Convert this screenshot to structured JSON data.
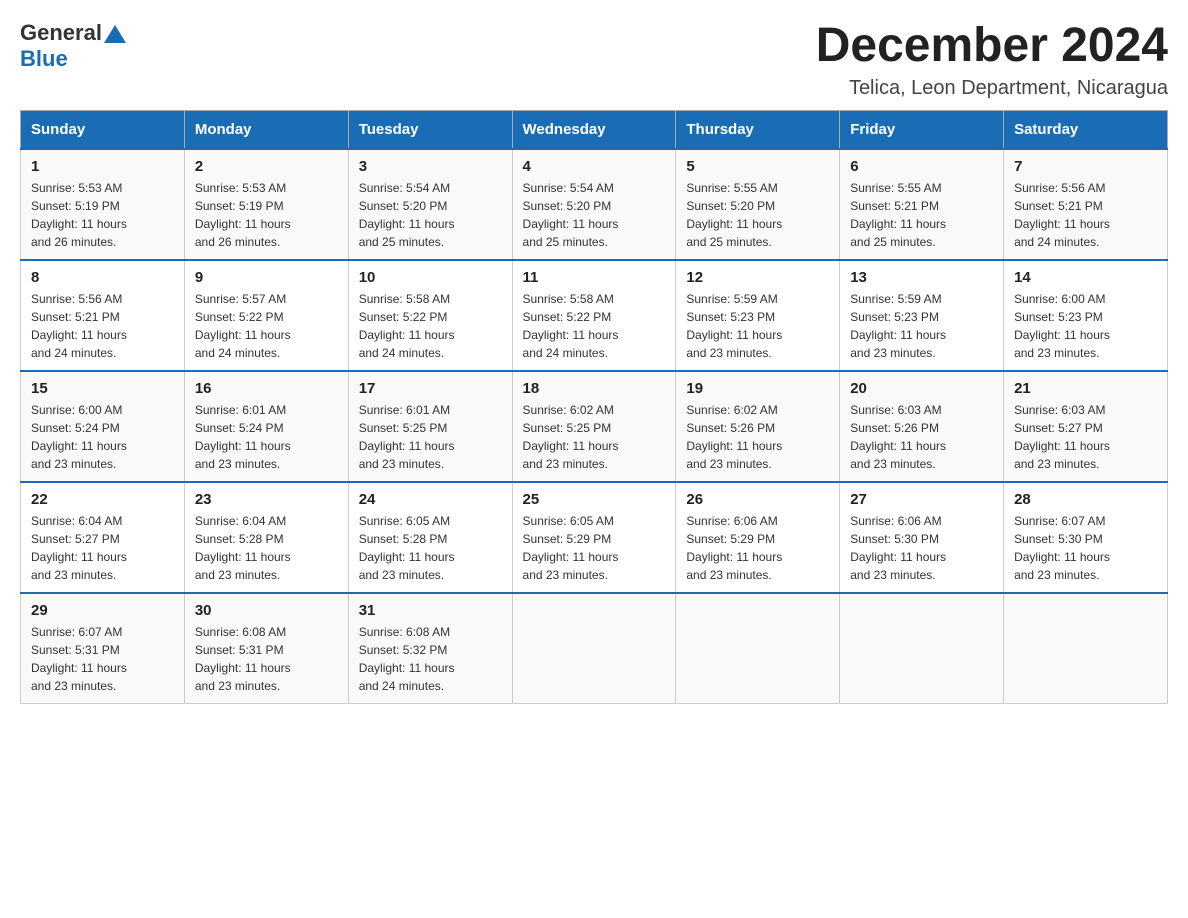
{
  "header": {
    "title": "December 2024",
    "subtitle": "Telica, Leon Department, Nicaragua",
    "logo_general": "General",
    "logo_blue": "Blue"
  },
  "days_of_week": [
    "Sunday",
    "Monday",
    "Tuesday",
    "Wednesday",
    "Thursday",
    "Friday",
    "Saturday"
  ],
  "weeks": [
    [
      {
        "day": "1",
        "sunrise": "5:53 AM",
        "sunset": "5:19 PM",
        "daylight": "11 hours and 26 minutes."
      },
      {
        "day": "2",
        "sunrise": "5:53 AM",
        "sunset": "5:19 PM",
        "daylight": "11 hours and 26 minutes."
      },
      {
        "day": "3",
        "sunrise": "5:54 AM",
        "sunset": "5:20 PM",
        "daylight": "11 hours and 25 minutes."
      },
      {
        "day": "4",
        "sunrise": "5:54 AM",
        "sunset": "5:20 PM",
        "daylight": "11 hours and 25 minutes."
      },
      {
        "day": "5",
        "sunrise": "5:55 AM",
        "sunset": "5:20 PM",
        "daylight": "11 hours and 25 minutes."
      },
      {
        "day": "6",
        "sunrise": "5:55 AM",
        "sunset": "5:21 PM",
        "daylight": "11 hours and 25 minutes."
      },
      {
        "day": "7",
        "sunrise": "5:56 AM",
        "sunset": "5:21 PM",
        "daylight": "11 hours and 24 minutes."
      }
    ],
    [
      {
        "day": "8",
        "sunrise": "5:56 AM",
        "sunset": "5:21 PM",
        "daylight": "11 hours and 24 minutes."
      },
      {
        "day": "9",
        "sunrise": "5:57 AM",
        "sunset": "5:22 PM",
        "daylight": "11 hours and 24 minutes."
      },
      {
        "day": "10",
        "sunrise": "5:58 AM",
        "sunset": "5:22 PM",
        "daylight": "11 hours and 24 minutes."
      },
      {
        "day": "11",
        "sunrise": "5:58 AM",
        "sunset": "5:22 PM",
        "daylight": "11 hours and 24 minutes."
      },
      {
        "day": "12",
        "sunrise": "5:59 AM",
        "sunset": "5:23 PM",
        "daylight": "11 hours and 23 minutes."
      },
      {
        "day": "13",
        "sunrise": "5:59 AM",
        "sunset": "5:23 PM",
        "daylight": "11 hours and 23 minutes."
      },
      {
        "day": "14",
        "sunrise": "6:00 AM",
        "sunset": "5:23 PM",
        "daylight": "11 hours and 23 minutes."
      }
    ],
    [
      {
        "day": "15",
        "sunrise": "6:00 AM",
        "sunset": "5:24 PM",
        "daylight": "11 hours and 23 minutes."
      },
      {
        "day": "16",
        "sunrise": "6:01 AM",
        "sunset": "5:24 PM",
        "daylight": "11 hours and 23 minutes."
      },
      {
        "day": "17",
        "sunrise": "6:01 AM",
        "sunset": "5:25 PM",
        "daylight": "11 hours and 23 minutes."
      },
      {
        "day": "18",
        "sunrise": "6:02 AM",
        "sunset": "5:25 PM",
        "daylight": "11 hours and 23 minutes."
      },
      {
        "day": "19",
        "sunrise": "6:02 AM",
        "sunset": "5:26 PM",
        "daylight": "11 hours and 23 minutes."
      },
      {
        "day": "20",
        "sunrise": "6:03 AM",
        "sunset": "5:26 PM",
        "daylight": "11 hours and 23 minutes."
      },
      {
        "day": "21",
        "sunrise": "6:03 AM",
        "sunset": "5:27 PM",
        "daylight": "11 hours and 23 minutes."
      }
    ],
    [
      {
        "day": "22",
        "sunrise": "6:04 AM",
        "sunset": "5:27 PM",
        "daylight": "11 hours and 23 minutes."
      },
      {
        "day": "23",
        "sunrise": "6:04 AM",
        "sunset": "5:28 PM",
        "daylight": "11 hours and 23 minutes."
      },
      {
        "day": "24",
        "sunrise": "6:05 AM",
        "sunset": "5:28 PM",
        "daylight": "11 hours and 23 minutes."
      },
      {
        "day": "25",
        "sunrise": "6:05 AM",
        "sunset": "5:29 PM",
        "daylight": "11 hours and 23 minutes."
      },
      {
        "day": "26",
        "sunrise": "6:06 AM",
        "sunset": "5:29 PM",
        "daylight": "11 hours and 23 minutes."
      },
      {
        "day": "27",
        "sunrise": "6:06 AM",
        "sunset": "5:30 PM",
        "daylight": "11 hours and 23 minutes."
      },
      {
        "day": "28",
        "sunrise": "6:07 AM",
        "sunset": "5:30 PM",
        "daylight": "11 hours and 23 minutes."
      }
    ],
    [
      {
        "day": "29",
        "sunrise": "6:07 AM",
        "sunset": "5:31 PM",
        "daylight": "11 hours and 23 minutes."
      },
      {
        "day": "30",
        "sunrise": "6:08 AM",
        "sunset": "5:31 PM",
        "daylight": "11 hours and 23 minutes."
      },
      {
        "day": "31",
        "sunrise": "6:08 AM",
        "sunset": "5:32 PM",
        "daylight": "11 hours and 24 minutes."
      },
      null,
      null,
      null,
      null
    ]
  ],
  "labels": {
    "sunrise": "Sunrise:",
    "sunset": "Sunset:",
    "daylight": "Daylight:"
  }
}
